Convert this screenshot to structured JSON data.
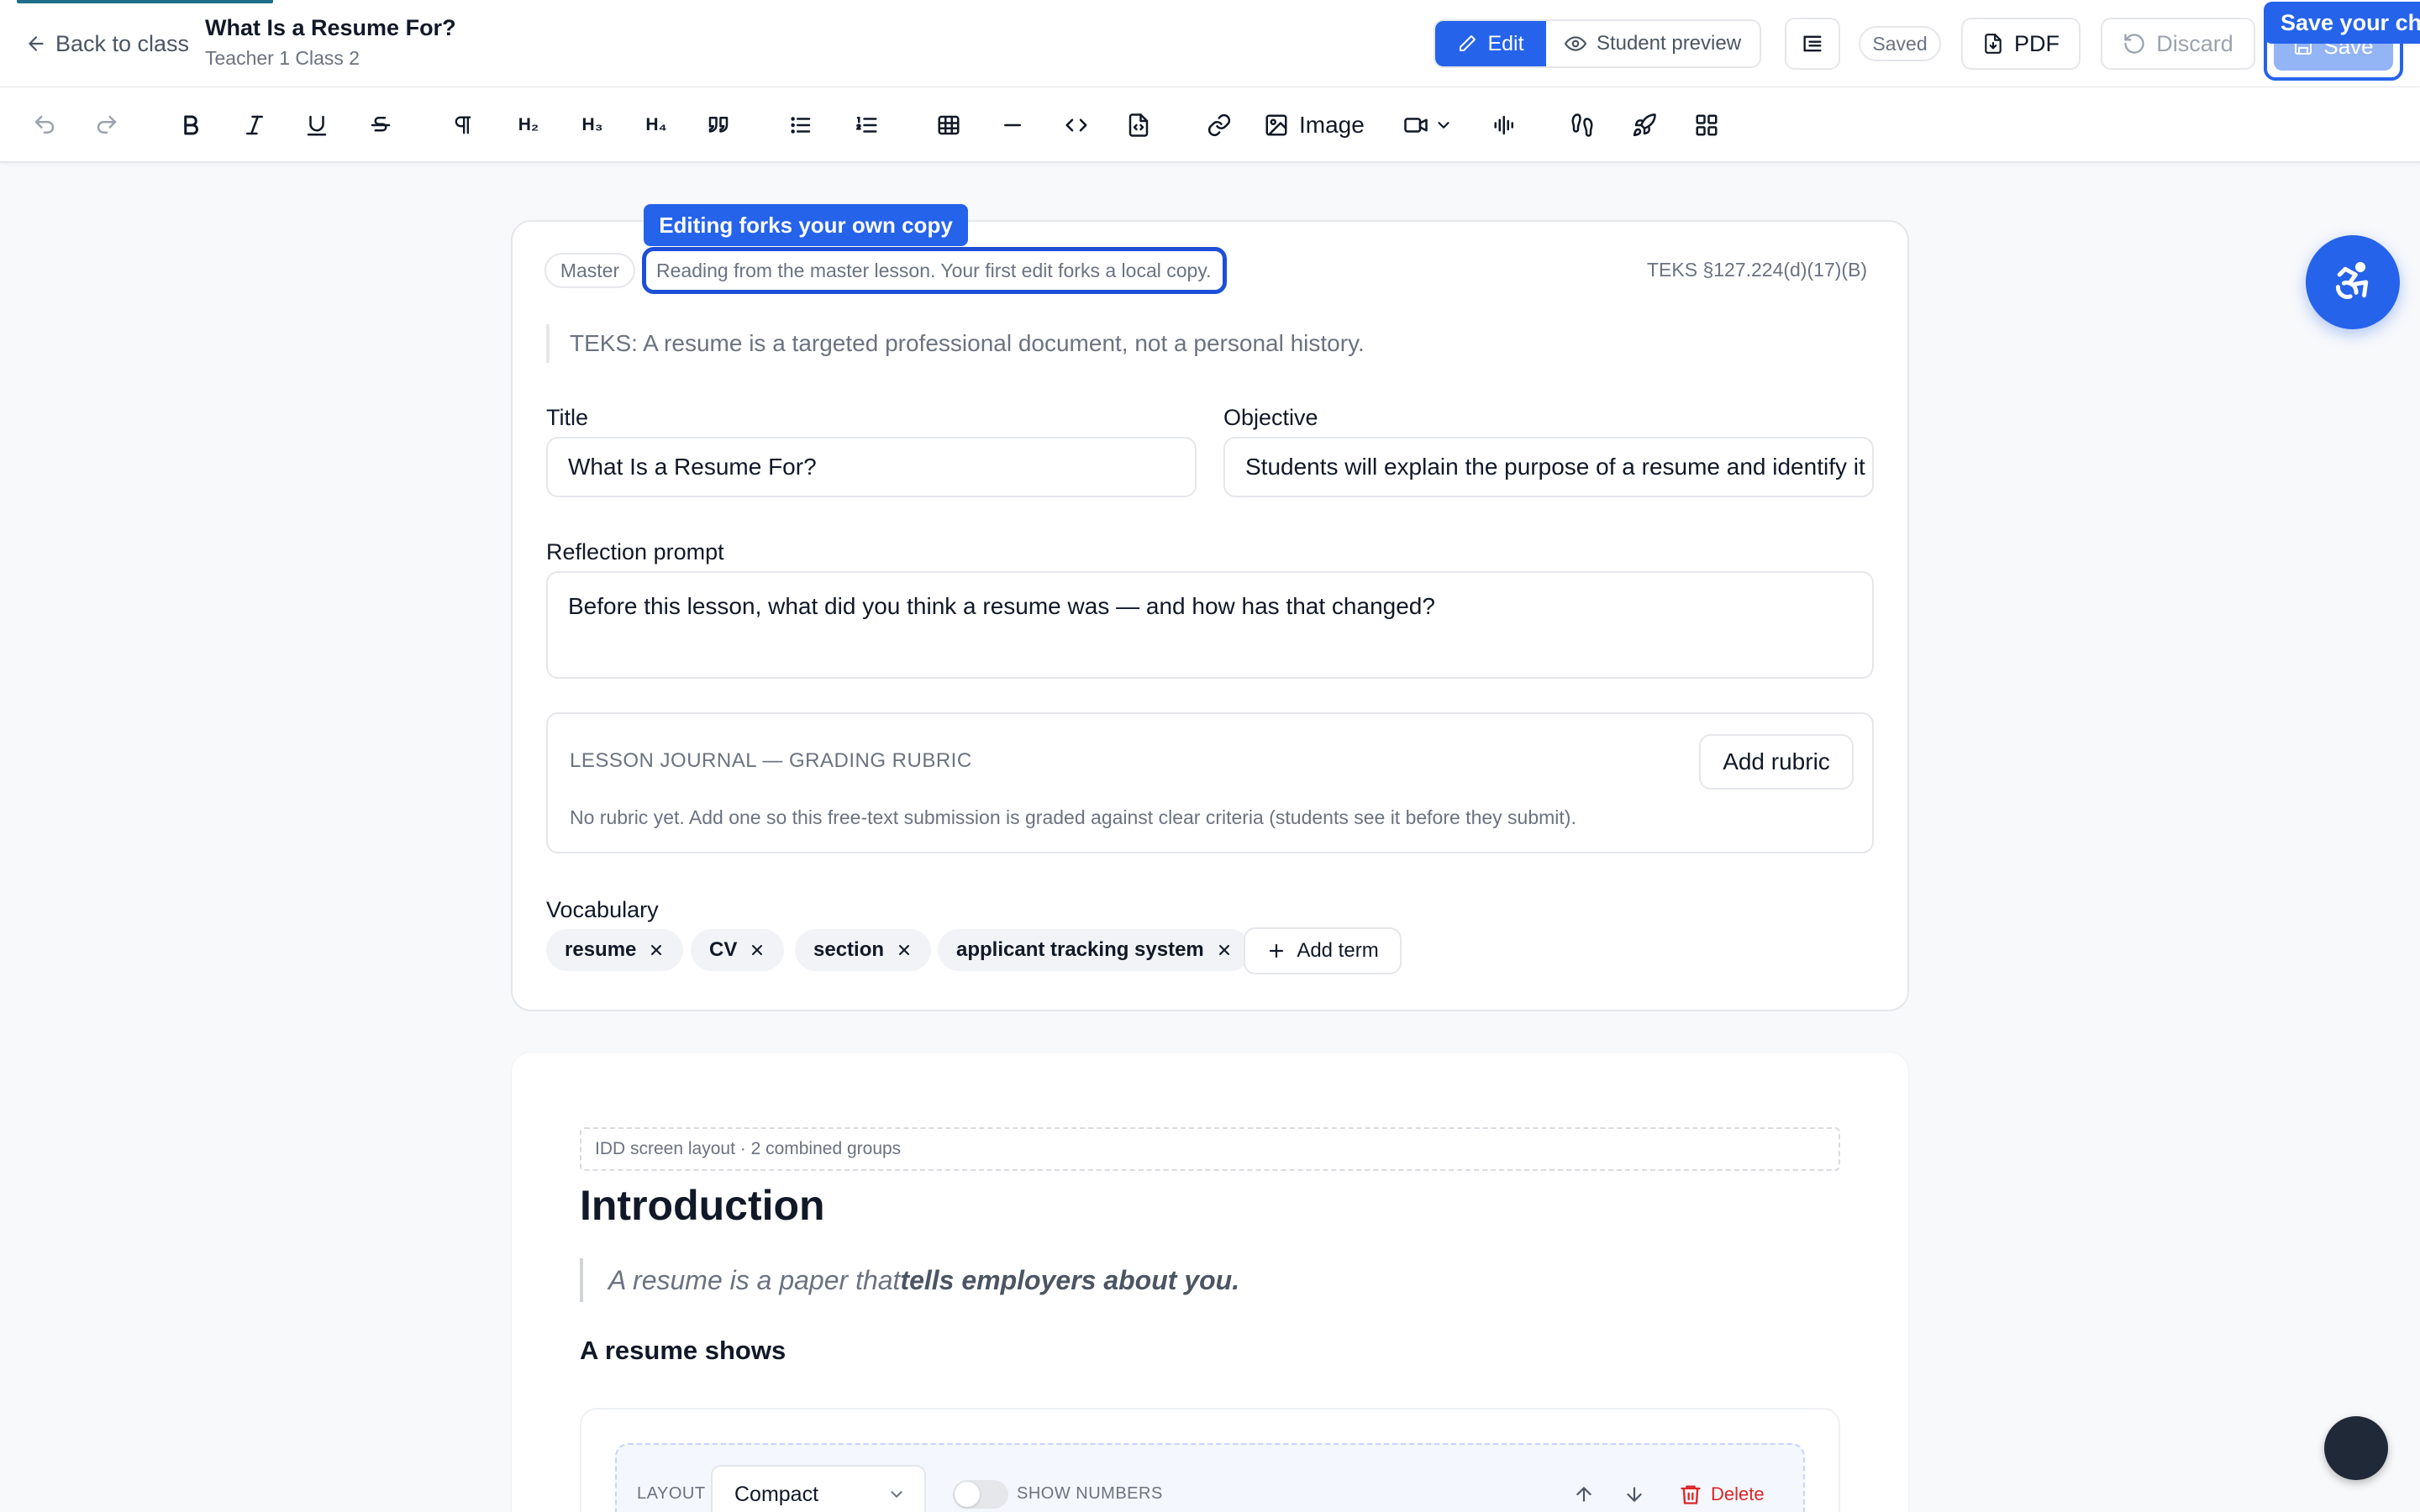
{
  "header": {
    "back_label": "Back to class",
    "title": "What Is a Resume For?",
    "subtitle": "Teacher 1 Class 2",
    "mode_edit": "Edit",
    "mode_preview": "Student preview",
    "saved": "Saved",
    "pdf": "PDF",
    "discard": "Discard",
    "save": "Save",
    "save_tooltip": "Save your ch"
  },
  "toolbar": {
    "h2": "H₂",
    "h3": "H₃",
    "h4": "H₄",
    "image_label": "Image"
  },
  "lesson": {
    "fork_tooltip": "Editing forks your own copy",
    "master_badge": "Master",
    "fork_note": "Reading from the master lesson. Your first edit forks a local copy.",
    "teks_code": "TEKS §127.224(d)(17)(B)",
    "teks_quote": "TEKS: A resume is a targeted professional document, not a personal history.",
    "title_label": "Title",
    "title_value": "What Is a Resume For?",
    "objective_label": "Objective",
    "objective_value": "Students will explain the purpose of a resume and identify it",
    "reflection_label": "Reflection prompt",
    "reflection_value": "Before this lesson, what did you think a resume was — and how has that changed?",
    "rubric": {
      "heading": "LESSON JOURNAL — GRADING RUBRIC",
      "button": "Add rubric",
      "note": "No rubric yet. Add one so this free-text submission is graded against clear criteria (students see it before they submit)."
    },
    "vocab_label": "Vocabulary",
    "vocab": [
      "resume",
      "CV",
      "section",
      "applicant tracking system"
    ],
    "add_term": "Add term"
  },
  "content": {
    "layout_tag": "IDD screen layout · 2 combined groups",
    "heading": "Introduction",
    "quote_plain": "A resume is a paper that ",
    "quote_bold": "tells employers about you.",
    "subheading": "A resume shows",
    "layout_label": "LAYOUT",
    "layout_value": "Compact",
    "show_numbers_label": "SHOW NUMBERS",
    "delete_label": "Delete"
  },
  "colors": {
    "primary": "#2563eb",
    "danger": "#dc2626",
    "muted_text": "#6b7280"
  }
}
